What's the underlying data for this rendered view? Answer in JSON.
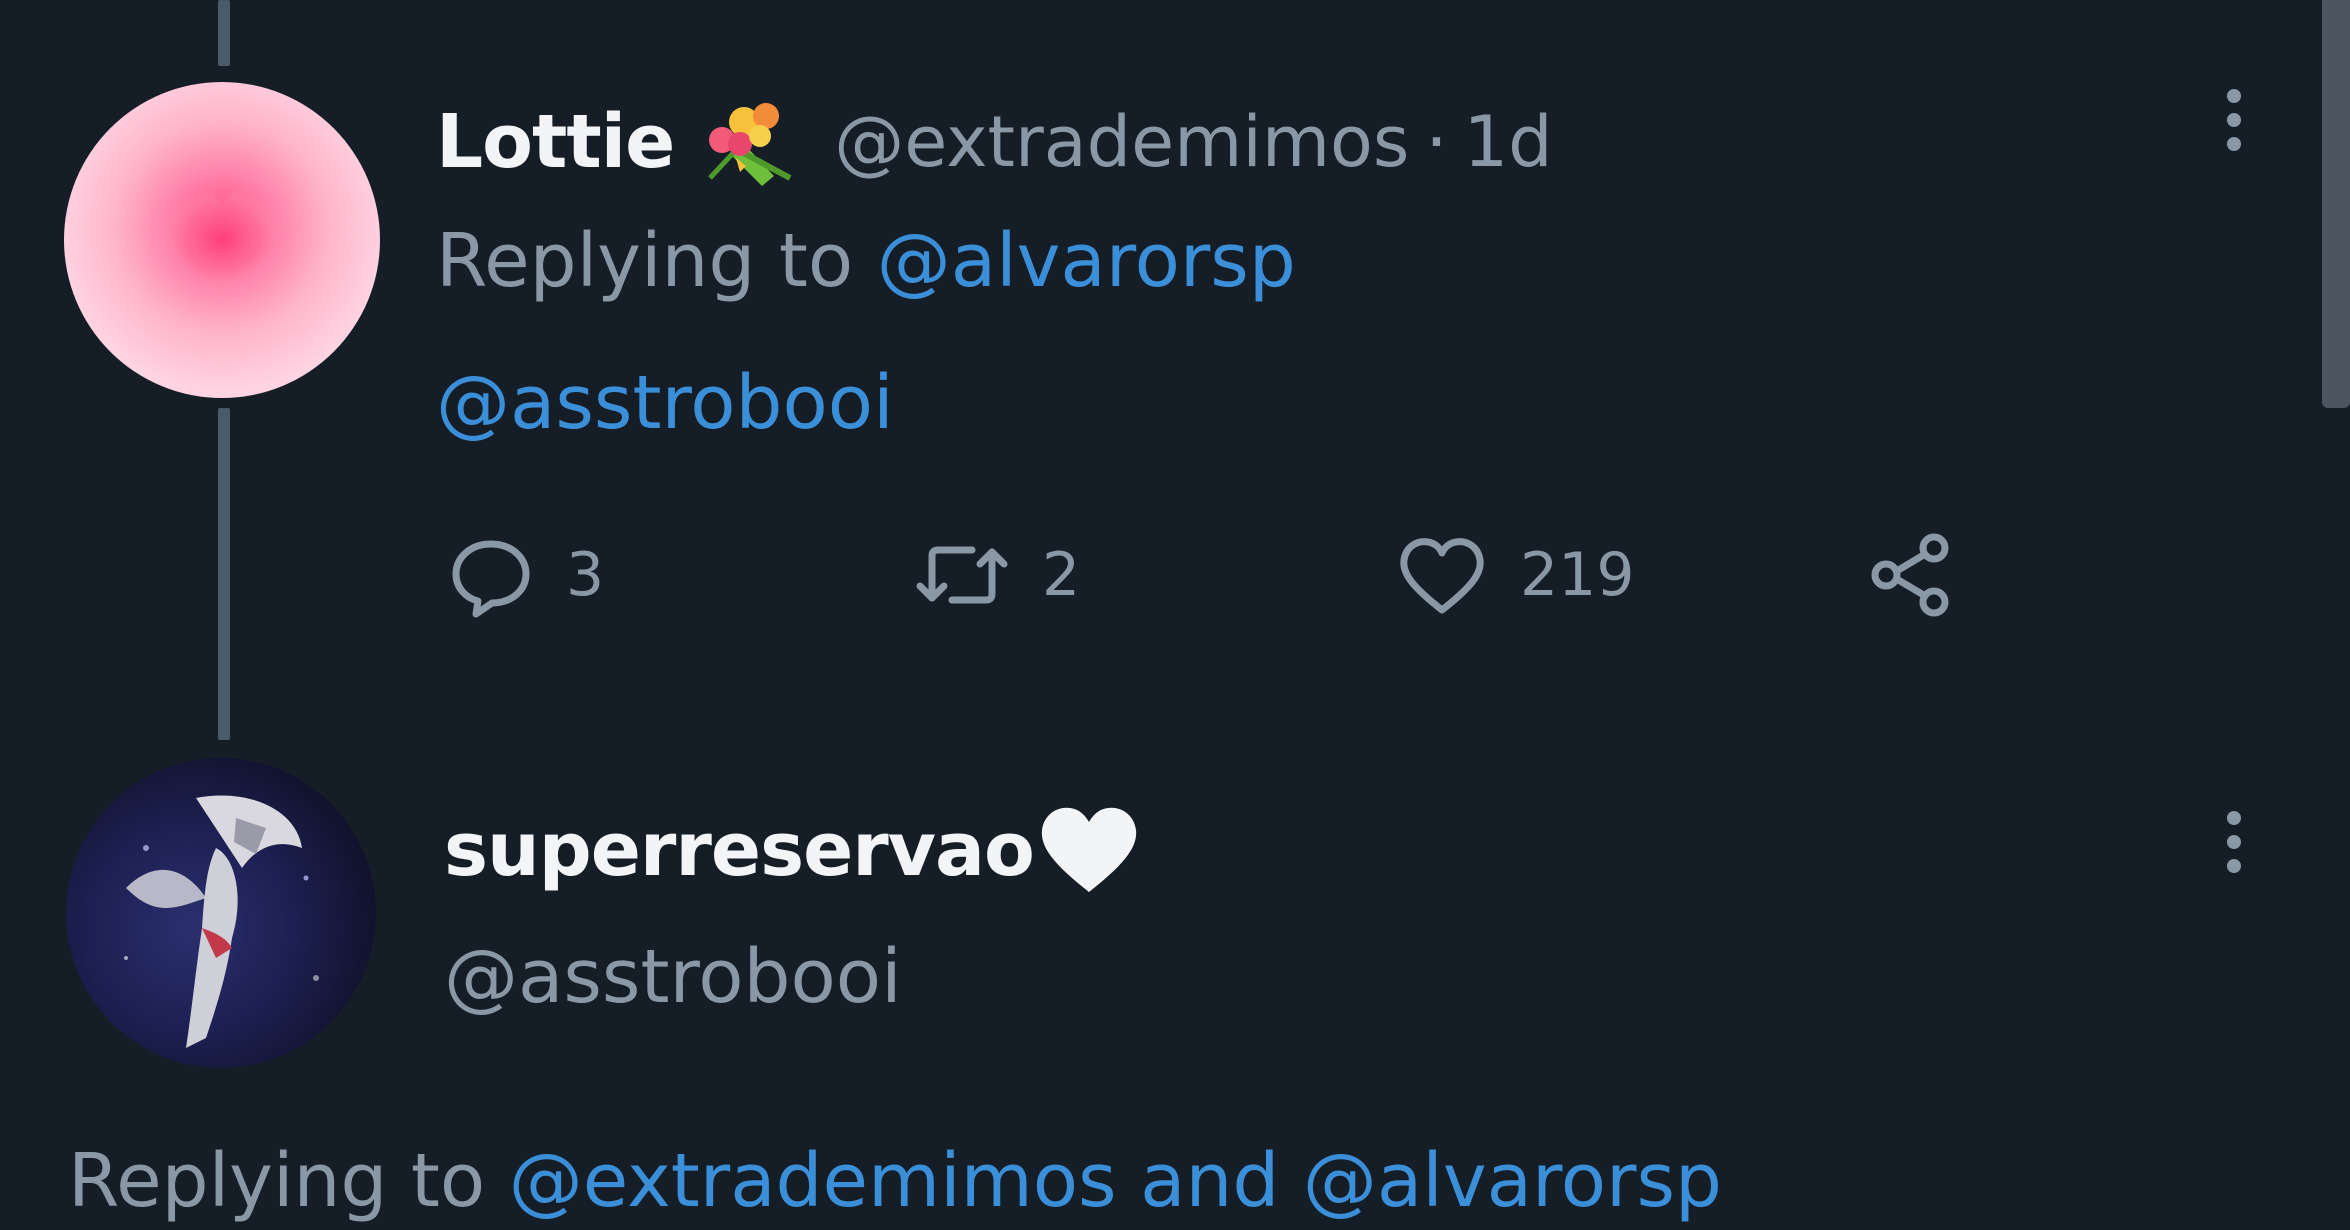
{
  "tweet": {
    "display_name": "Lottie",
    "name_emoji": "bouquet-icon",
    "handle": "@extrademimos",
    "separator": "·",
    "time": "1d",
    "replying_prefix": "Replying to",
    "replying_to": "@alvarorsp",
    "body_mention": "@asstrobooi",
    "actions": {
      "reply_count": "3",
      "retweet_count": "2",
      "like_count": "219"
    }
  },
  "reply": {
    "display_name": "superreservao",
    "name_emoji": "white-heart-icon",
    "handle": "@asstrobooi",
    "replying_prefix": "Replying to",
    "replying_to_1": "@extrademimos",
    "conjunction": "and",
    "replying_to_2": "@alvarorsp"
  },
  "colors": {
    "background": "#151d26",
    "text_primary": "#f2f4f5",
    "text_secondary": "#8a98a6",
    "link": "#3b8fd9",
    "thread_line": "#4b5a68"
  }
}
